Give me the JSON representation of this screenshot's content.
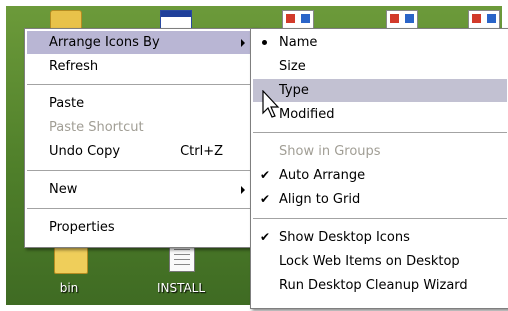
{
  "desktop": {
    "icons": [
      {
        "label": "bin"
      },
      {
        "label": "INSTALL"
      }
    ]
  },
  "context_menu": {
    "items": [
      {
        "label": "Arrange Icons By",
        "submenu": true,
        "highlighted": true
      },
      {
        "label": "Refresh"
      },
      {
        "label": "Paste"
      },
      {
        "label": "Paste Shortcut",
        "disabled": true
      },
      {
        "label": "Undo Copy",
        "accel": "Ctrl+Z"
      },
      {
        "label": "New",
        "submenu": true
      },
      {
        "label": "Properties"
      }
    ]
  },
  "arrange_submenu": {
    "items": [
      {
        "label": "Name",
        "mark": "bullet"
      },
      {
        "label": "Size"
      },
      {
        "label": "Type",
        "highlighted": true
      },
      {
        "label": "Modified"
      },
      {
        "label": "Show in Groups",
        "disabled": true
      },
      {
        "label": "Auto Arrange",
        "mark": "check"
      },
      {
        "label": "Align to Grid",
        "mark": "check"
      },
      {
        "label": "Show Desktop Icons",
        "mark": "check"
      },
      {
        "label": "Lock Web Items on Desktop"
      },
      {
        "label": "Run Desktop Cleanup Wizard"
      }
    ]
  },
  "icons": {
    "bullet": "radio-bullet-icon",
    "check": "checkmark-icon",
    "submenu": "submenu-arrow-icon",
    "cursor": "mouse-pointer-icon"
  },
  "colors": {
    "menu_highlight": "#b9b6d4",
    "disabled_text": "#a19e95",
    "desktop_green": "#4f7f2a"
  }
}
